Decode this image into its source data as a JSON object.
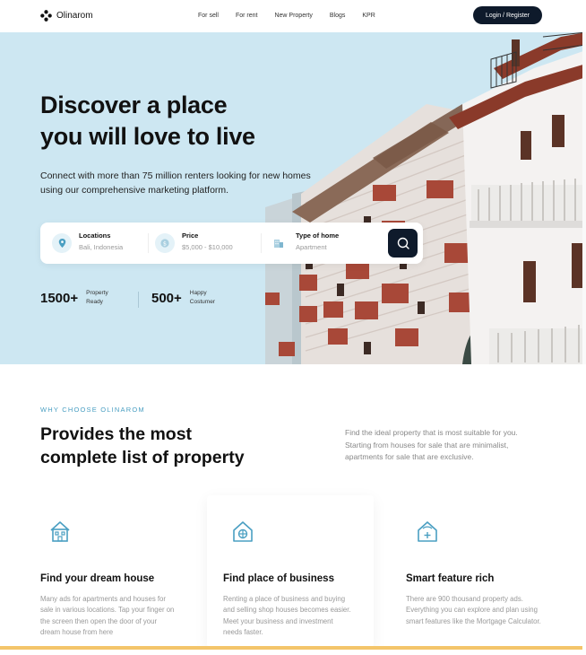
{
  "brand": {
    "name": "Olinarom",
    "logo_icon": "flower-icon"
  },
  "nav": {
    "links": [
      "For sell",
      "For rent",
      "New Property",
      "Blogs",
      "KPR"
    ],
    "login_label": "Login / Register"
  },
  "hero": {
    "title_line1": "Discover a place",
    "title_line2": "you will love to live",
    "subtitle_line1": "Connect with more than 75 million renters looking for new homes",
    "subtitle_line2": "using our comprehensive marketing platform."
  },
  "search": {
    "fields": [
      {
        "label": "Locations",
        "value": "Bali, Indonesia",
        "icon": "map-pin-icon"
      },
      {
        "label": "Price",
        "value": "$5,000 - $10,000",
        "icon": "dollar-icon"
      },
      {
        "label": "Type of home",
        "value": "Apartment",
        "icon": "building-icon"
      }
    ],
    "button_icon": "search-icon"
  },
  "stats": [
    {
      "number": "1500+",
      "label_line1": "Property",
      "label_line2": "Ready"
    },
    {
      "number": "500+",
      "label_line1": "Happy",
      "label_line2": "Costumer"
    }
  ],
  "why": {
    "tag": "WHY CHOOSE OLINAROM",
    "title_line1": "Provides the most",
    "title_line2": "complete list of property",
    "description": "Find the ideal property that is most suitable for you. Starting from houses for sale that are minimalist, apartments for sale that are exclusive."
  },
  "features": [
    {
      "icon": "house-icon",
      "title": "Find your dream house",
      "description": "Many ads for apartments and houses for sale in various locations. Tap your finger on the screen then open the door of your dream house from here"
    },
    {
      "icon": "shop-icon",
      "title": "Find place of business",
      "description": "Renting a place of business and buying and selling shop houses becomes easier. Meet your business and investment needs faster."
    },
    {
      "icon": "smart-home-icon",
      "title": "Smart feature rich",
      "description": "There are 900 thousand property ads. Everything you can explore and plan using smart features like the Mortgage Calculator."
    }
  ],
  "colors": {
    "accent": "#4a9fc2",
    "dark": "#0e1a2b",
    "hero_bg": "#cde7f2",
    "footer_accent": "#f4c56a"
  }
}
